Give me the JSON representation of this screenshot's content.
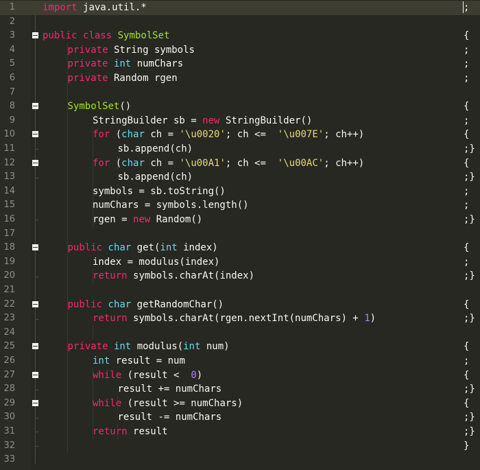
{
  "editor": {
    "lines": [
      {
        "n": "1",
        "indent": 0,
        "fold": false,
        "tail": ";",
        "tokens": [
          [
            "kw",
            "import"
          ],
          [
            "",
            "java.util.*"
          ]
        ]
      },
      {
        "n": "2",
        "indent": 0,
        "fold": false,
        "tail": "",
        "tokens": []
      },
      {
        "n": "3",
        "indent": 0,
        "fold": true,
        "tail": "{",
        "tokens": [
          [
            "kw",
            "public"
          ],
          [
            "kw",
            "class"
          ],
          [
            "cls",
            "SymbolSet"
          ]
        ]
      },
      {
        "n": "4",
        "indent": 1,
        "fold": false,
        "tail": ";",
        "tokens": [
          [
            "kw",
            "private"
          ],
          [
            "",
            "String symbols"
          ]
        ]
      },
      {
        "n": "5",
        "indent": 1,
        "fold": false,
        "tail": ";",
        "tokens": [
          [
            "kw",
            "private"
          ],
          [
            "ty",
            "int"
          ],
          [
            "",
            "numChars"
          ]
        ]
      },
      {
        "n": "6",
        "indent": 1,
        "fold": false,
        "tail": ";",
        "tokens": [
          [
            "kw",
            "private"
          ],
          [
            "",
            "Random rgen"
          ]
        ]
      },
      {
        "n": "7",
        "indent": 0,
        "fold": false,
        "tail": "",
        "tokens": []
      },
      {
        "n": "8",
        "indent": 1,
        "fold": true,
        "tail": "{",
        "tokens": [
          [
            "fn",
            "SymbolSet"
          ],
          [
            "raw",
            "()"
          ]
        ]
      },
      {
        "n": "9",
        "indent": 2,
        "fold": false,
        "tail": ";",
        "tokens": [
          [
            "",
            "StringBuilder sb ="
          ],
          [
            "kw",
            "new"
          ],
          [
            "",
            "StringBuilder()"
          ]
        ]
      },
      {
        "n": "10",
        "indent": 2,
        "fold": true,
        "tail": "{",
        "tokens": [
          [
            "kw",
            "for"
          ],
          [
            "raw",
            " ("
          ],
          [
            "ty",
            "char"
          ],
          [
            "",
            "ch ="
          ],
          [
            "str",
            "'\\u0020'"
          ],
          [
            "raw",
            "; ch <= "
          ],
          [
            "str",
            "'\\u007E'"
          ],
          [
            "raw",
            "; ch++)"
          ]
        ]
      },
      {
        "n": "11",
        "indent": 3,
        "fold": false,
        "tail": ";}",
        "tokens": [
          [
            "",
            "sb.append(ch)"
          ]
        ]
      },
      {
        "n": "12",
        "indent": 2,
        "fold": true,
        "tail": "{",
        "tokens": [
          [
            "kw",
            "for"
          ],
          [
            "raw",
            " ("
          ],
          [
            "ty",
            "char"
          ],
          [
            "",
            "ch ="
          ],
          [
            "str",
            "'\\u00A1'"
          ],
          [
            "raw",
            "; ch <= "
          ],
          [
            "str",
            "'\\u00AC'"
          ],
          [
            "raw",
            "; ch++)"
          ]
        ]
      },
      {
        "n": "13",
        "indent": 3,
        "fold": false,
        "tail": ";}",
        "tokens": [
          [
            "",
            "sb.append(ch)"
          ]
        ]
      },
      {
        "n": "14",
        "indent": 2,
        "fold": false,
        "tail": ";",
        "tokens": [
          [
            "",
            "symbols = sb.toString()"
          ]
        ]
      },
      {
        "n": "15",
        "indent": 2,
        "fold": false,
        "tail": ";",
        "tokens": [
          [
            "",
            "numChars = symbols.length()"
          ]
        ]
      },
      {
        "n": "16",
        "indent": 2,
        "fold": false,
        "tail": ";}",
        "tokens": [
          [
            "",
            "rgen ="
          ],
          [
            "kw",
            "new"
          ],
          [
            "",
            "Random()"
          ]
        ]
      },
      {
        "n": "17",
        "indent": 0,
        "fold": false,
        "tail": "",
        "tokens": []
      },
      {
        "n": "18",
        "indent": 1,
        "fold": true,
        "tail": "{",
        "tokens": [
          [
            "kw",
            "public"
          ],
          [
            "ty",
            "char"
          ],
          [
            "",
            "get("
          ],
          [
            "ty",
            "int"
          ],
          [
            "",
            "index)"
          ]
        ]
      },
      {
        "n": "19",
        "indent": 2,
        "fold": false,
        "tail": ";",
        "tokens": [
          [
            "",
            "index = modulus(index)"
          ]
        ]
      },
      {
        "n": "20",
        "indent": 2,
        "fold": false,
        "tail": ";}",
        "tokens": [
          [
            "kw",
            "return"
          ],
          [
            "",
            "symbols.charAt(index)"
          ]
        ]
      },
      {
        "n": "21",
        "indent": 0,
        "fold": false,
        "tail": "",
        "tokens": []
      },
      {
        "n": "22",
        "indent": 1,
        "fold": true,
        "tail": "{",
        "tokens": [
          [
            "kw",
            "public"
          ],
          [
            "ty",
            "char"
          ],
          [
            "",
            "getRandomChar()"
          ]
        ]
      },
      {
        "n": "23",
        "indent": 2,
        "fold": false,
        "tail": ";}",
        "tokens": [
          [
            "kw",
            "return"
          ],
          [
            "",
            "symbols.charAt(rgen.nextInt(numChars) +"
          ],
          [
            "num",
            "1"
          ],
          [
            "raw",
            ")"
          ]
        ]
      },
      {
        "n": "24",
        "indent": 0,
        "fold": false,
        "tail": "",
        "tokens": []
      },
      {
        "n": "25",
        "indent": 1,
        "fold": true,
        "tail": "{",
        "tokens": [
          [
            "kw",
            "private"
          ],
          [
            "ty",
            "int"
          ],
          [
            "",
            "modulus("
          ],
          [
            "ty",
            "int"
          ],
          [
            "",
            "num)"
          ]
        ]
      },
      {
        "n": "26",
        "indent": 2,
        "fold": false,
        "tail": ";",
        "tokens": [
          [
            "ty",
            "int"
          ],
          [
            "",
            "result = num"
          ]
        ]
      },
      {
        "n": "27",
        "indent": 2,
        "fold": true,
        "tail": "{",
        "tokens": [
          [
            "kw",
            "while"
          ],
          [
            "raw",
            " (result < "
          ],
          [
            "num",
            "0"
          ],
          [
            "raw",
            ")"
          ]
        ]
      },
      {
        "n": "28",
        "indent": 3,
        "fold": false,
        "tail": ";}",
        "tokens": [
          [
            "",
            "result += numChars"
          ]
        ]
      },
      {
        "n": "29",
        "indent": 2,
        "fold": true,
        "tail": "{",
        "tokens": [
          [
            "kw",
            "while"
          ],
          [
            "raw",
            " (result >= numChars)"
          ]
        ]
      },
      {
        "n": "30",
        "indent": 3,
        "fold": false,
        "tail": ";}",
        "tokens": [
          [
            "",
            "result -= numChars"
          ]
        ]
      },
      {
        "n": "31",
        "indent": 2,
        "fold": false,
        "tail": ";}",
        "tokens": [
          [
            "kw",
            "return"
          ],
          [
            "",
            "result"
          ]
        ]
      },
      {
        "n": "32",
        "indent": 0,
        "fold": false,
        "tail": "}",
        "tokens": []
      },
      {
        "n": "33",
        "indent": 0,
        "fold": false,
        "tail": "",
        "tokens": []
      }
    ],
    "current_line": "1",
    "theme": {
      "background": "#272822",
      "keyword": "#f92672",
      "type": "#66d9ef",
      "class_name": "#a6e22e",
      "string": "#e6db74",
      "number": "#ae81ff",
      "text": "#f8f8f2"
    }
  }
}
